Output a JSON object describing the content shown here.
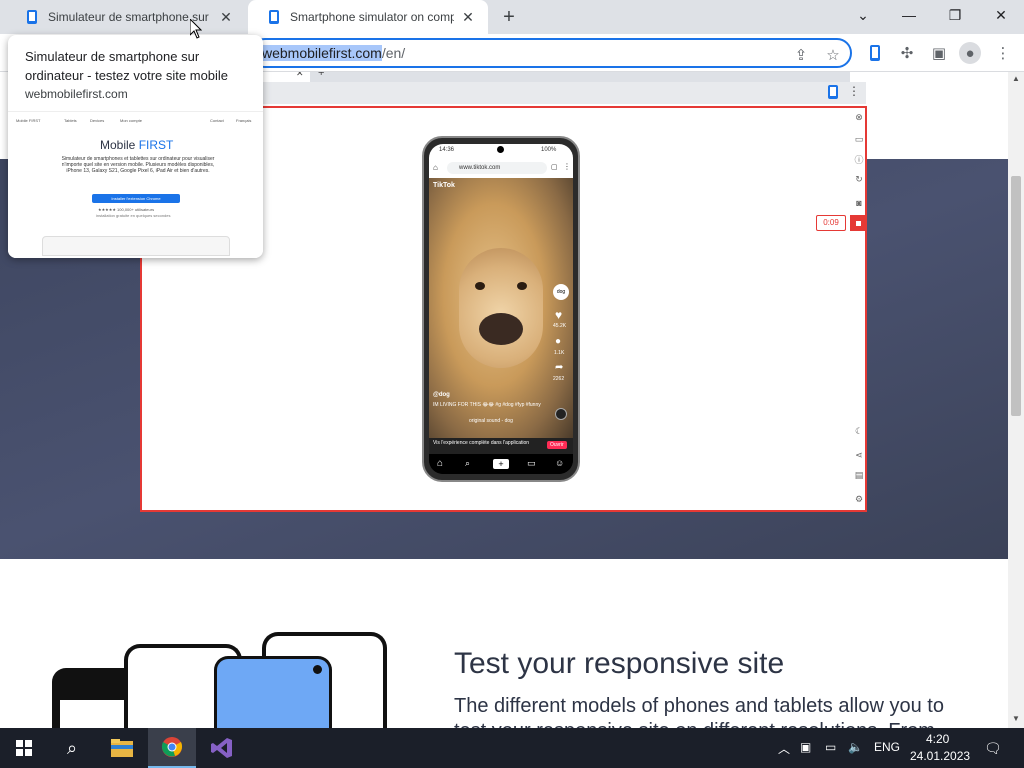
{
  "browser": {
    "tabs": [
      {
        "title": "Simulateur de smartphone sur ordinateur - testez votre site mobile",
        "active": false
      },
      {
        "title": "Smartphone simulator on computer",
        "active": true
      }
    ],
    "new_tab_icon": "plus-icon",
    "address": {
      "selected": "webmobilefirst.com",
      "path": "/en/"
    },
    "toolbar_icons": [
      "share-icon",
      "star-icon",
      "extension-mobilefirst-icon",
      "puzzle-icon",
      "sidepanel-icon",
      "profile-icon",
      "menu-icon"
    ]
  },
  "hovercard": {
    "title": "Simulateur de smartphone sur ordinateur - testez votre site mobile",
    "domain": "webmobilefirst.com",
    "preview": {
      "nav": [
        "Mobile FIRST",
        "Tablets",
        "Devices",
        "Mon compte",
        "Contact",
        "Français"
      ],
      "brand_a": "Mobile",
      "brand_b": "FIRST",
      "desc": "Simulateur de smartphones et tablettes sur ordinateur pour visualiser n'importe quel site en version mobile. Plusieurs modèles disponibles, iPhone 13, Galaxy S21, Google Pixel 6, iPad Air et bien d'autres.",
      "button": "Installer l'extension Chrome",
      "rating": "★★★★★ 100,000+ utilisateurs",
      "note": "installation gratuite en quelques secondes"
    }
  },
  "phone": {
    "status_time": "14:36",
    "status_battery": "100%",
    "url": "www.tiktok.com",
    "app_label": "TikTok",
    "user": "@dog",
    "caption": "IM LIVING FOR THIS 😂😂 #g #dog #fyp #funny",
    "sound": "original sound - dog",
    "side_counts": [
      "45.2K",
      "1.1K",
      "2262"
    ],
    "banner_text": "Vis l'expérience complète dans l'application",
    "banner_button": "Ouvrir"
  },
  "emulator": {
    "timer": "0:09"
  },
  "content": {
    "title": "Test your responsive site",
    "text": "The different models of phones and tablets allow you to test your responsive site on different resolutions. From"
  },
  "taskbar": {
    "lang": "ENG",
    "time": "4:20",
    "date": "24.01.2023"
  },
  "colors": {
    "accent": "#1a73e8",
    "emu_border": "#e53935",
    "hero": "#434b66",
    "text_dark": "#2d3445"
  }
}
